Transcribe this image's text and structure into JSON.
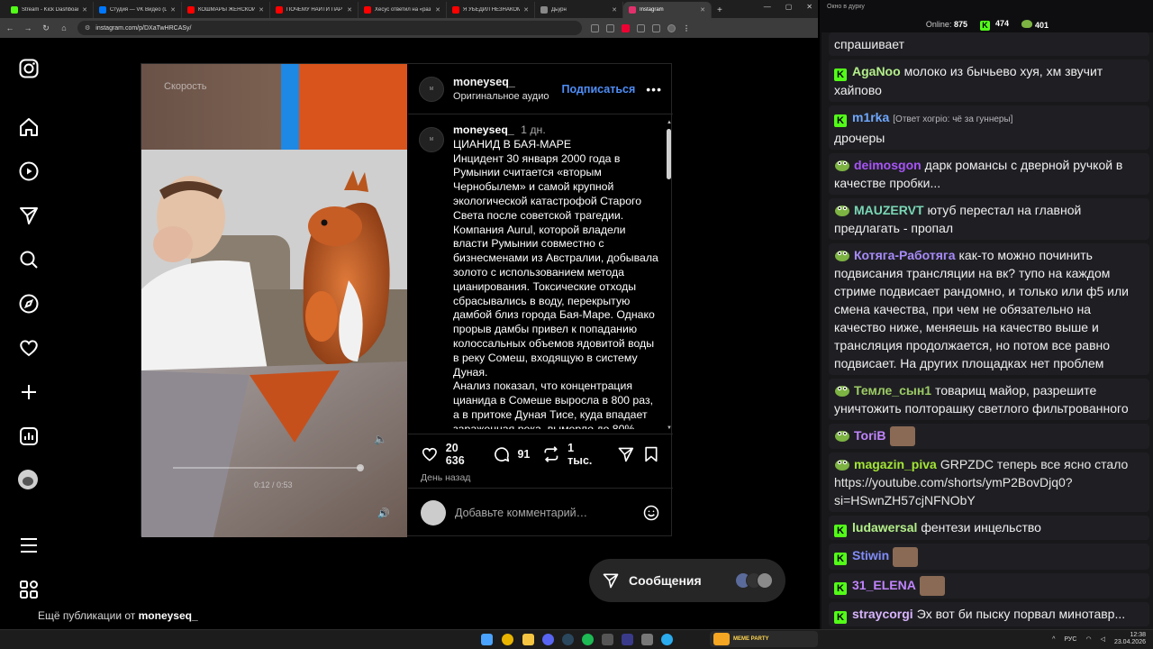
{
  "browser": {
    "tabs": [
      {
        "label": "Stream - Kick Dashboard",
        "color": "#53fc18"
      },
      {
        "label": "Студия — VK Видео (Live)",
        "color": "#0077ff"
      },
      {
        "label": "КОШМАРЫ ЖЕНСКОЙ",
        "color": "#ff0000"
      },
      {
        "label": "ПОЧЕМУ НАЙТИ ПАРТ",
        "color": "#ff0000"
      },
      {
        "label": "Хесус ответил на «раз",
        "color": "#ff0000"
      },
      {
        "label": "Я УБЕДИЛ НЕЗНАКОМ",
        "color": "#ff0000"
      },
      {
        "label": "Дьурн",
        "color": "#888888"
      },
      {
        "label": "Instagram",
        "color": "#e1306c"
      }
    ],
    "url": "instagram.com/p/DXaTwHRCASy/"
  },
  "ig": {
    "more_prefix": "Ещё публикации от ",
    "more_user": "moneyseq_",
    "media_speed": "Скорость",
    "media_time": "0:12 / 0:53",
    "author": "moneyseq_",
    "audio": "Оригинальное аудио",
    "follow": "Подписаться",
    "caption_user": "moneyseq_",
    "caption_age": "1 дн.",
    "caption_text": "ЦИАНИД В БАЯ-МАРЕ\nИнцидент 30 января 2000 года в Румынии считается «вторым Чернобылем» и самой крупной экологической катастрофой Старого Света после советской трагедии. Компания Aurul, которой владели власти Румынии совместно с бизнесменами из Австралии, добывала золото с использованием метода цианирования. Токсические отходы сбрасывались в воду, перекрытую дамбой близ города Бая-Маре. Однако прорыв дамбы привел к попаданию колоссальных объемов ядовитой воды в реку Сомеш, входящую в систему Дуная.\nАнализ показал, что концентрация цианида в Сомеше выросла в 800 раз, а в притоке Дуная Тисе, куда впадает зараженная река, вымерло до 80%",
    "likes": "20 636",
    "comments": "91",
    "reposts": "1 тыс.",
    "posted": "День назад",
    "comment_placeholder": "Добавьте комментарий…",
    "messages": "Сообщения"
  },
  "chat": {
    "window_title": "Окно в дуркy",
    "online_label": "Online:",
    "online": "875",
    "kick_count": "474",
    "other_count": "401",
    "messages": [
      {
        "badge": "none",
        "user": "",
        "color": "#efeff1",
        "text": "спрашивает"
      },
      {
        "badge": "k",
        "user": "AgaNoo",
        "color": "#b4f08a",
        "text": "молоко из бычьево хуя, хм звучит хайпово"
      },
      {
        "badge": "k",
        "user": "m1rka",
        "color": "#6fa8ff",
        "reply": "[Ответ хогрio: чё за гуннеры]",
        "text": "дрочеры"
      },
      {
        "badge": "p",
        "user": "deimosgon",
        "color": "#a855f7",
        "text": "дарк романсы с дверной ручкой в качестве пробки..."
      },
      {
        "badge": "p",
        "user": "MAUZERVT",
        "color": "#7ad7b5",
        "text": "ютуб перестал на главной предлагать - пропал"
      },
      {
        "badge": "p",
        "user": "Котяга-Работяга",
        "color": "#a78bfa",
        "text": "как-то можно починить подвисания трансляции на вк? тупо на каждом стриме подвисает рандомно, и только или ф5 или смена качества, при чем не обязательно на качество ниже, меняешь на качество выше и трансляция продолжается, но потом все равно подвисает. На других площадках нет проблем"
      },
      {
        "badge": "p",
        "user": "Темле_сын1",
        "color": "#9ccc65",
        "text": "товарищ майор, разрешите уничтожить полторашку светлого фильтрованного"
      },
      {
        "badge": "p",
        "user": "ToriB",
        "color": "#c084fc",
        "text": ""
      },
      {
        "badge": "p",
        "user": "magazin_piva",
        "color": "#a3e635",
        "text": "GRPZDC теперь все ясно стало https://youtube.com/shorts/ymP2BovDjq0?si=HSwnZH57cjNFNObY"
      },
      {
        "badge": "k",
        "user": "ludawersal",
        "color": "#b4f08a",
        "text": "фентези инцельство"
      },
      {
        "badge": "k",
        "user": "Stiwin",
        "color": "#818cf8",
        "text": ""
      },
      {
        "badge": "k",
        "user": "31_ELENA",
        "color": "#c084fc",
        "text": ""
      },
      {
        "badge": "k",
        "user": "straycorgi",
        "color": "#d8b4fe",
        "text": "Эх вот би пыску порвал минотавр..."
      }
    ]
  },
  "taskbar": {
    "lang": "РУС",
    "time": "12:38",
    "date": "23.04.2026",
    "meme": "MEME PARTY"
  }
}
